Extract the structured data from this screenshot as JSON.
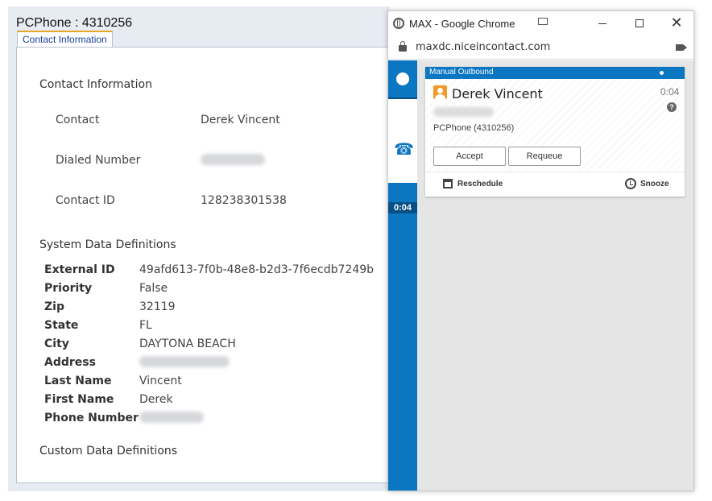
{
  "left_panel": {
    "page_title": "PCPhone : 4310256",
    "tab_label": "Contact Information",
    "contact_section_title": "Contact Information",
    "fields": {
      "contact": {
        "label": "Contact",
        "value": "Derek Vincent"
      },
      "dialed_number": {
        "label": "Dialed Number"
      },
      "contact_id": {
        "label": "Contact ID",
        "value": "128238301538"
      }
    },
    "system_section_title": "System Data Definitions",
    "system_fields": [
      {
        "label": "External ID",
        "value": "49afd613-7f0b-48e8-b2d3-7f6ecdb7249b"
      },
      {
        "label": "Priority",
        "value": "False"
      },
      {
        "label": "Zip",
        "value": "32119"
      },
      {
        "label": "State",
        "value": "FL"
      },
      {
        "label": "City",
        "value": "DAYTONA BEACH"
      },
      {
        "label": "Address",
        "value": ""
      },
      {
        "label": "Last Name",
        "value": "Vincent"
      },
      {
        "label": "First Name",
        "value": "Derek"
      },
      {
        "label": "Phone Number",
        "value": ""
      }
    ],
    "custom_section_title": "Custom Data Definitions"
  },
  "chrome_window": {
    "title": "MAX - Google Chrome",
    "url": "maxdc.niceincontact.com",
    "close_glyph": "✕"
  },
  "max_app": {
    "sidebar_timer": "0:04",
    "phone_icon_glyph": "☎",
    "card": {
      "header_label": "Manual Outbound",
      "contact_name": "Derek Vincent",
      "timer": "0:04",
      "help_glyph": "?",
      "skill": "PCPhone (4310256)",
      "accept_label": "Accept",
      "requeue_label": "Requeue",
      "reschedule_label": "Reschedule",
      "snooze_label": "Snooze"
    }
  },
  "colors": {
    "max_blue": "#0b76c2",
    "max_dark_blue": "#084f86",
    "tab_accent": "#e5a823",
    "contact_icon": "#f0982a",
    "panel_bg": "#e7ebf2"
  }
}
